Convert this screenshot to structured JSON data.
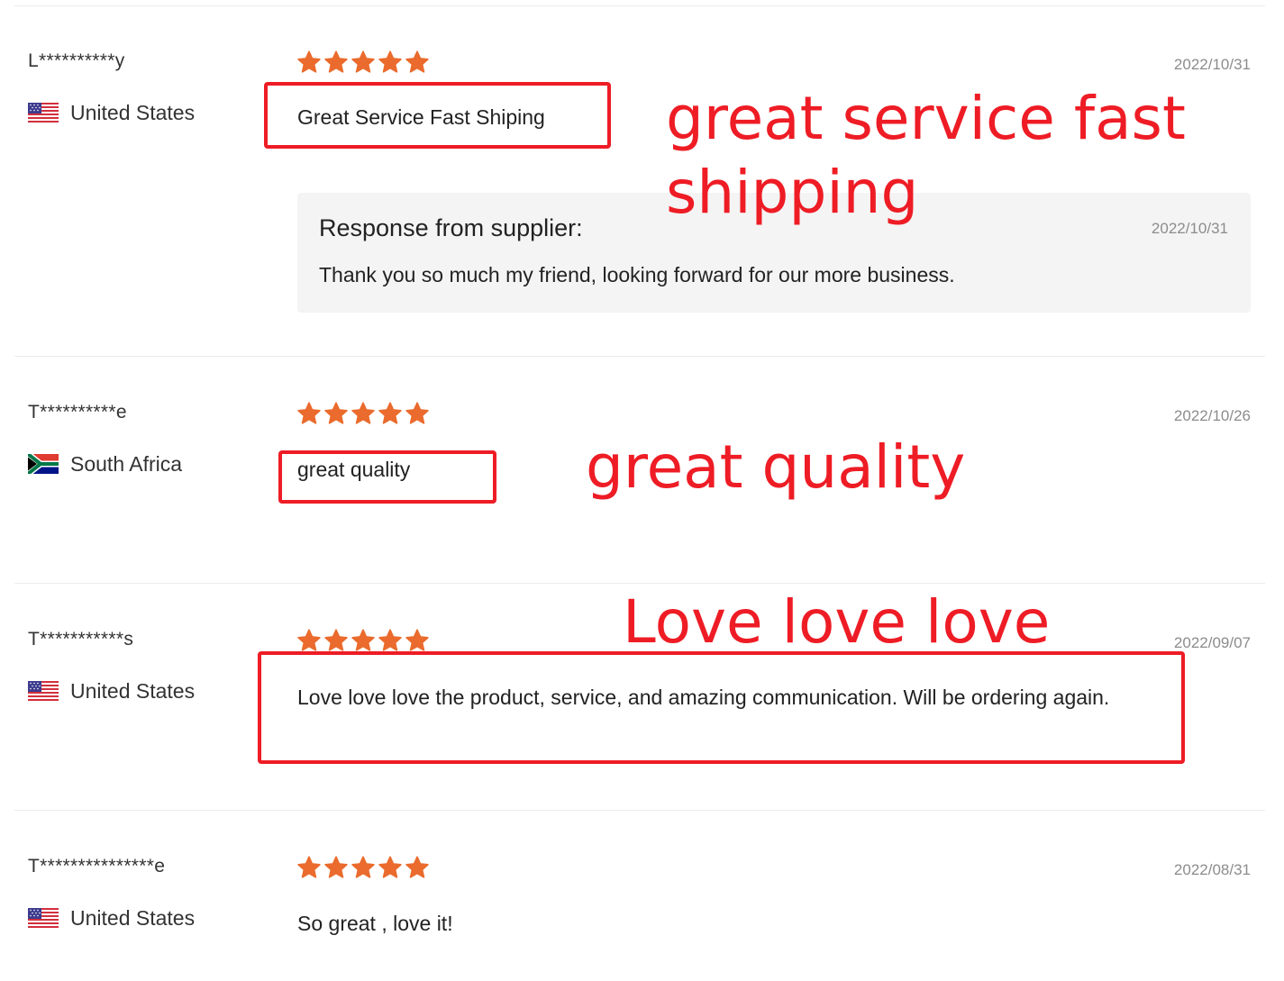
{
  "colors": {
    "star": "#ea6b2d",
    "annotation": "#ee1c25",
    "response_bg": "#f4f4f4"
  },
  "reviews": [
    {
      "user": "L**********y",
      "country": "United States",
      "flag": "us-flag",
      "rating": 5,
      "date": "2022/10/31",
      "text": "Great Service Fast Shiping",
      "response": {
        "title": "Response from supplier:",
        "date": "2022/10/31",
        "text": "Thank you so much my friend, looking forward for our more business."
      }
    },
    {
      "user": "T**********e",
      "country": "South Africa",
      "flag": "za-flag",
      "rating": 5,
      "date": "2022/10/26",
      "text": "great quality"
    },
    {
      "user": "T***********s",
      "country": "United States",
      "flag": "us-flag",
      "rating": 5,
      "date": "2022/09/07",
      "text": "Love love love the product, service, and amazing communication. Will be ordering again."
    },
    {
      "user": "T***************e",
      "country": "United States",
      "flag": "us-flag",
      "rating": 5,
      "date": "2022/08/31",
      "text": "So great , love it!"
    }
  ],
  "annotations": {
    "first_line1": "great service fast",
    "first_line2": "shipping",
    "second": "great quality",
    "third": "Love love love"
  }
}
